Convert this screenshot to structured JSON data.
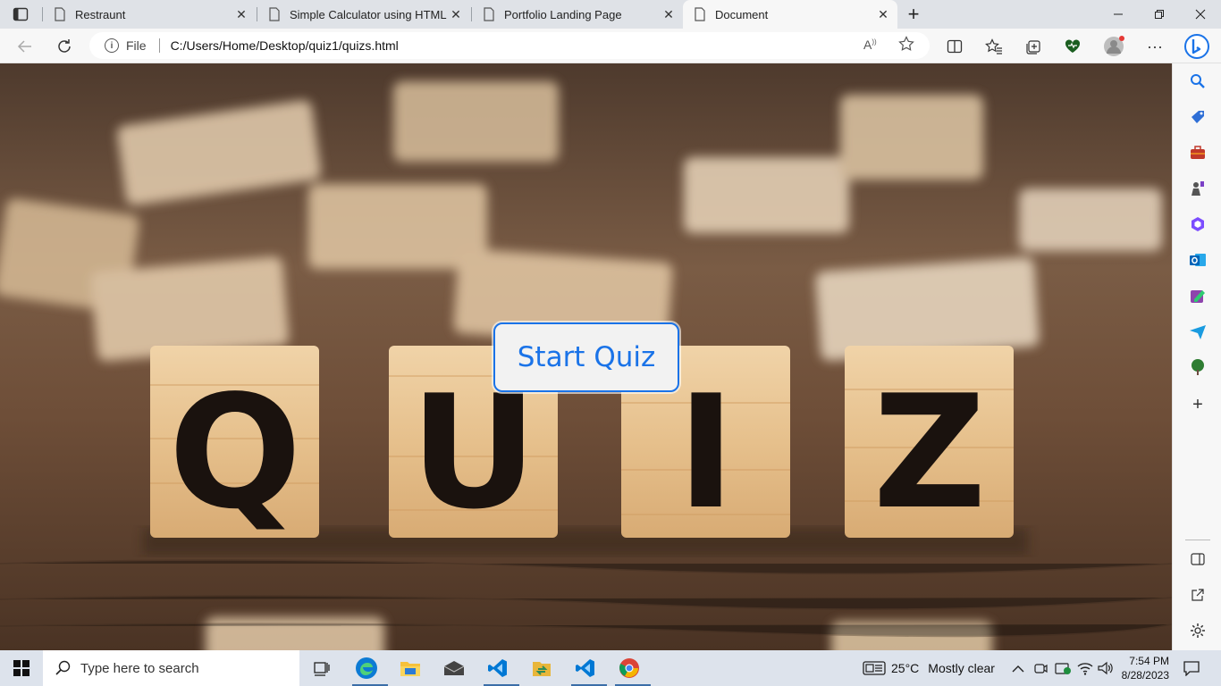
{
  "browser": {
    "tabs": [
      {
        "label": "Restraunt",
        "active": false
      },
      {
        "label": "Simple Calculator using HTML, C",
        "active": false
      },
      {
        "label": "Portfolio Landing Page",
        "active": false
      },
      {
        "label": "Document",
        "active": true
      }
    ],
    "address": {
      "scheme_label": "File",
      "url": "C:/Users/Home/Desktop/quiz1/quizs.html"
    }
  },
  "page": {
    "start_button_label": "Start Quiz",
    "background_tiles": [
      "Q",
      "U",
      "I",
      "Z"
    ]
  },
  "taskbar": {
    "search_placeholder": "Type here to search",
    "weather_temp": "25°C",
    "weather_text": "Mostly clear",
    "time": "7:54 PM",
    "date": "8/28/2023"
  },
  "colors": {
    "accent": "#1a73e8",
    "wood_dark": "#5a4030",
    "tile": "#e9c79b",
    "tile_letter": "#1a120e"
  }
}
